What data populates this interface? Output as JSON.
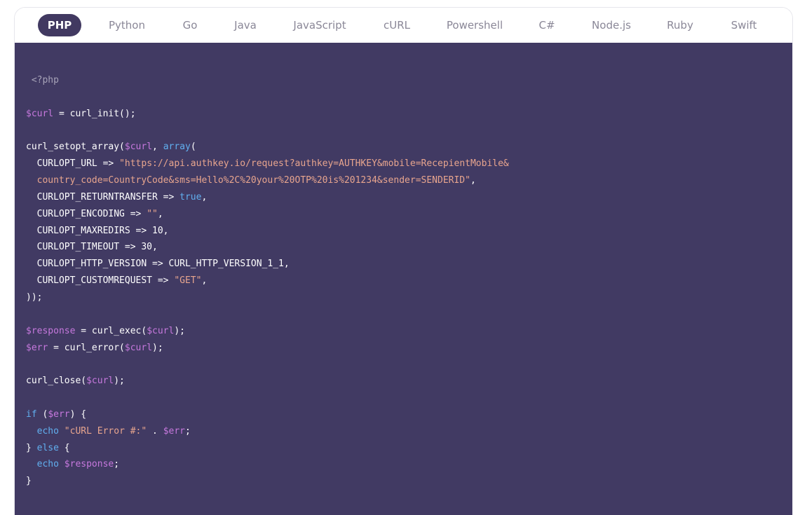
{
  "tabs": [
    {
      "id": "php",
      "label": "PHP",
      "active": true
    },
    {
      "id": "python",
      "label": "Python",
      "active": false
    },
    {
      "id": "go",
      "label": "Go",
      "active": false
    },
    {
      "id": "java",
      "label": "Java",
      "active": false
    },
    {
      "id": "javascript",
      "label": "JavaScript",
      "active": false
    },
    {
      "id": "curl",
      "label": "cURL",
      "active": false
    },
    {
      "id": "powershell",
      "label": "Powershell",
      "active": false
    },
    {
      "id": "csharp",
      "label": "C#",
      "active": false
    },
    {
      "id": "nodejs",
      "label": "Node.js",
      "active": false
    },
    {
      "id": "ruby",
      "label": "Ruby",
      "active": false
    },
    {
      "id": "swift",
      "label": "Swift",
      "active": false
    }
  ],
  "colors": {
    "panel_bg": "#413a63",
    "active_tab_bg": "#413961",
    "variable": "#c678dd",
    "string": "#e8a58e",
    "keyword": "#61afef",
    "php_tag": "#a7a3b8",
    "plain": "#ffffff"
  },
  "code": {
    "language": "php",
    "lines": [
      [
        {
          "t": "tag",
          "v": " <?php"
        }
      ],
      [],
      [
        {
          "t": "var",
          "v": "$curl"
        },
        {
          "t": "txt",
          "v": " = curl_init();"
        }
      ],
      [],
      [
        {
          "t": "txt",
          "v": "curl_setopt_array("
        },
        {
          "t": "var",
          "v": "$curl"
        },
        {
          "t": "txt",
          "v": ", "
        },
        {
          "t": "kw",
          "v": "array"
        },
        {
          "t": "txt",
          "v": "("
        }
      ],
      [
        {
          "t": "txt",
          "v": "  CURLOPT_URL => "
        },
        {
          "t": "str",
          "v": "\"https://api.authkey.io/request?authkey=AUTHKEY&mobile=RecepientMobile&"
        }
      ],
      [
        {
          "t": "str",
          "v": "  country_code=CountryCode&sms=Hello%2C%20your%20OTP%20is%201234&sender=SENDERID\""
        },
        {
          "t": "txt",
          "v": ","
        }
      ],
      [
        {
          "t": "txt",
          "v": "  CURLOPT_RETURNTRANSFER => "
        },
        {
          "t": "kw",
          "v": "true"
        },
        {
          "t": "txt",
          "v": ","
        }
      ],
      [
        {
          "t": "txt",
          "v": "  CURLOPT_ENCODING => "
        },
        {
          "t": "str",
          "v": "\"\""
        },
        {
          "t": "txt",
          "v": ","
        }
      ],
      [
        {
          "t": "txt",
          "v": "  CURLOPT_MAXREDIRS => 10,"
        }
      ],
      [
        {
          "t": "txt",
          "v": "  CURLOPT_TIMEOUT => 30,"
        }
      ],
      [
        {
          "t": "txt",
          "v": "  CURLOPT_HTTP_VERSION => CURL_HTTP_VERSION_1_1,"
        }
      ],
      [
        {
          "t": "txt",
          "v": "  CURLOPT_CUSTOMREQUEST => "
        },
        {
          "t": "str",
          "v": "\"GET\""
        },
        {
          "t": "txt",
          "v": ","
        }
      ],
      [
        {
          "t": "txt",
          "v": "));"
        }
      ],
      [],
      [
        {
          "t": "var",
          "v": "$response"
        },
        {
          "t": "txt",
          "v": " = curl_exec("
        },
        {
          "t": "var",
          "v": "$curl"
        },
        {
          "t": "txt",
          "v": ");"
        }
      ],
      [
        {
          "t": "var",
          "v": "$err"
        },
        {
          "t": "txt",
          "v": " = curl_error("
        },
        {
          "t": "var",
          "v": "$curl"
        },
        {
          "t": "txt",
          "v": ");"
        }
      ],
      [],
      [
        {
          "t": "txt",
          "v": "curl_close("
        },
        {
          "t": "var",
          "v": "$curl"
        },
        {
          "t": "txt",
          "v": ");"
        }
      ],
      [],
      [
        {
          "t": "kw",
          "v": "if"
        },
        {
          "t": "txt",
          "v": " ("
        },
        {
          "t": "var",
          "v": "$err"
        },
        {
          "t": "txt",
          "v": ") {"
        }
      ],
      [
        {
          "t": "txt",
          "v": "  "
        },
        {
          "t": "kw",
          "v": "echo"
        },
        {
          "t": "txt",
          "v": " "
        },
        {
          "t": "str",
          "v": "\"cURL Error #:\""
        },
        {
          "t": "txt",
          "v": " . "
        },
        {
          "t": "var",
          "v": "$err"
        },
        {
          "t": "txt",
          "v": ";"
        }
      ],
      [
        {
          "t": "txt",
          "v": "} "
        },
        {
          "t": "kw",
          "v": "else"
        },
        {
          "t": "txt",
          "v": " {"
        }
      ],
      [
        {
          "t": "txt",
          "v": "  "
        },
        {
          "t": "kw",
          "v": "echo"
        },
        {
          "t": "txt",
          "v": " "
        },
        {
          "t": "var",
          "v": "$response"
        },
        {
          "t": "txt",
          "v": ";"
        }
      ],
      [
        {
          "t": "txt",
          "v": "}"
        }
      ]
    ]
  }
}
